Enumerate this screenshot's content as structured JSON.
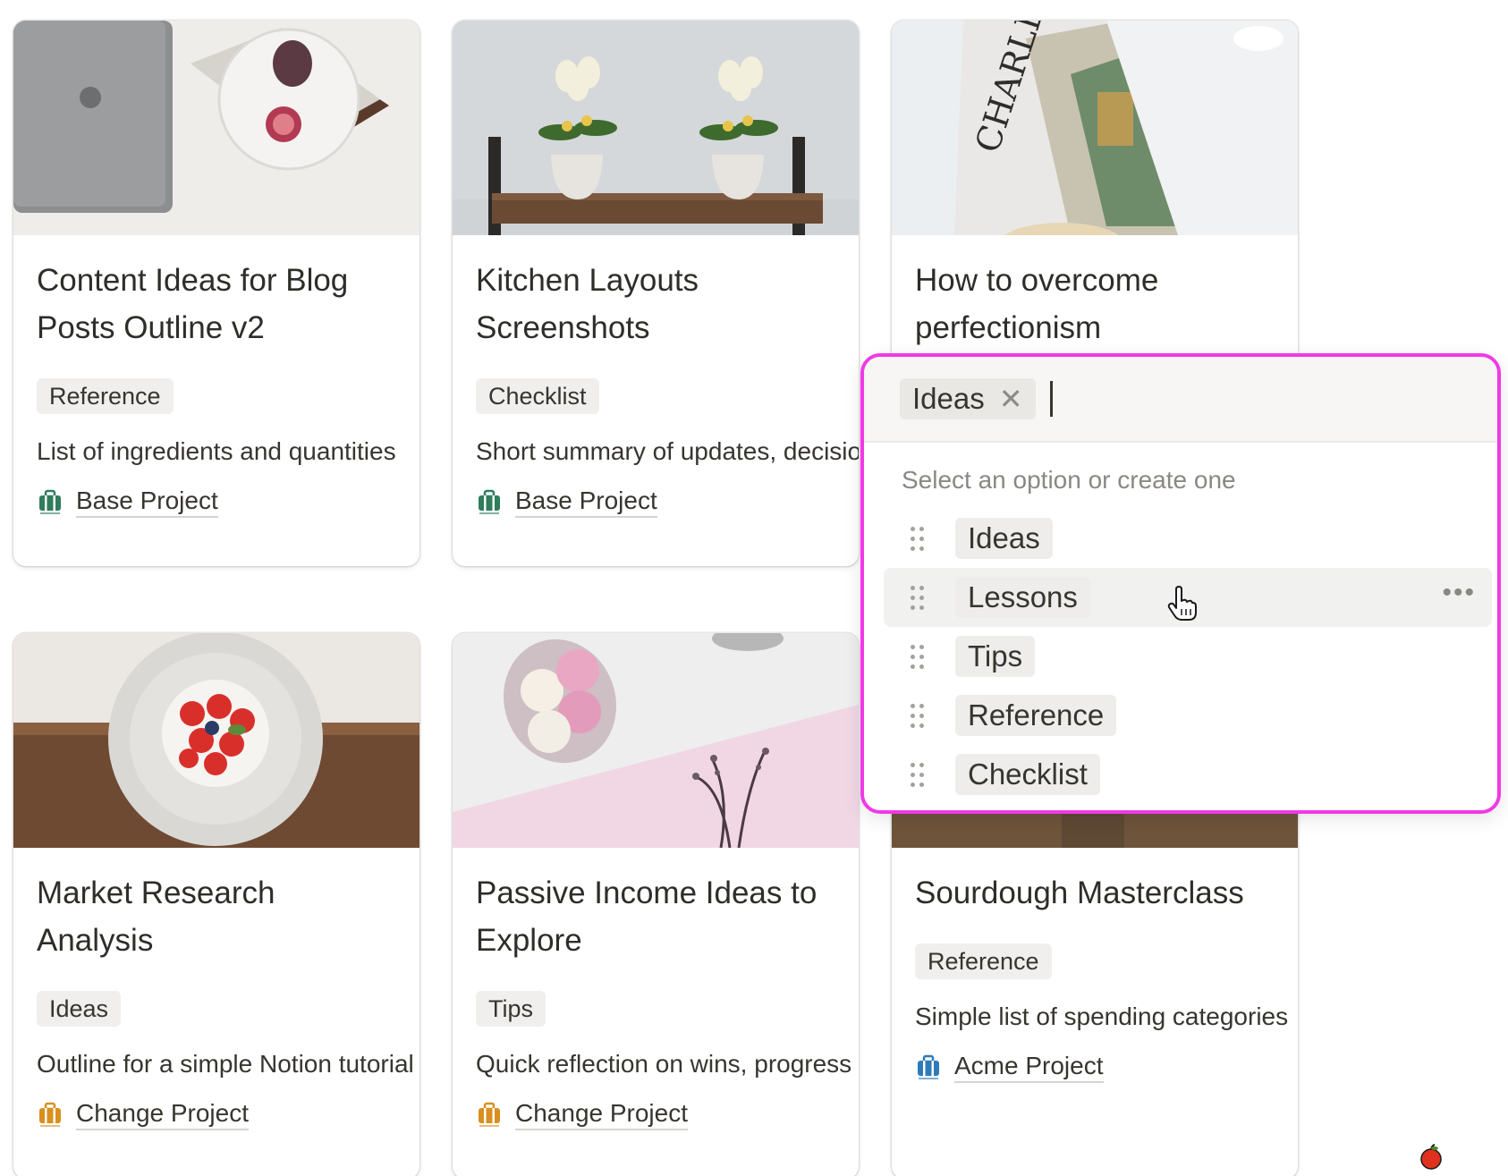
{
  "cards": [
    {
      "title": "Content Ideas for Blog Posts Outline v2",
      "tag": "Reference",
      "description": "List of ingredients and quantities",
      "project": "Base Project",
      "project_icon_color": "#2f7d5b"
    },
    {
      "title": "Kitchen Layouts Screenshots",
      "tag": "Checklist",
      "description": "Short summary of updates, decisions",
      "project": "Base Project",
      "project_icon_color": "#2f7d5b"
    },
    {
      "title": "How to overcome perfectionism",
      "tag": "",
      "description": "",
      "project": "",
      "project_icon_color": ""
    },
    {
      "title": "Market Research Analysis",
      "tag": "Ideas",
      "description": "Outline for a simple Notion tutorial",
      "project": "Change Project",
      "project_icon_color": "#d9901f"
    },
    {
      "title": "Passive Income Ideas to Explore",
      "tag": "Tips",
      "description": "Quick reflection on wins, progress",
      "project": "Change Project",
      "project_icon_color": "#d9901f"
    },
    {
      "title": "Sourdough Masterclass",
      "tag": "Reference",
      "description": "Simple list of spending categories",
      "project": "Acme Project",
      "project_icon_color": "#2f7bb8"
    }
  ],
  "dropdown": {
    "selected_chip": "Ideas",
    "hint": "Select an option or create one",
    "options": [
      "Ideas",
      "Lessons",
      "Tips",
      "Reference",
      "Checklist"
    ],
    "hovered_option": "Lessons",
    "highlight_color": "#f139e6"
  }
}
